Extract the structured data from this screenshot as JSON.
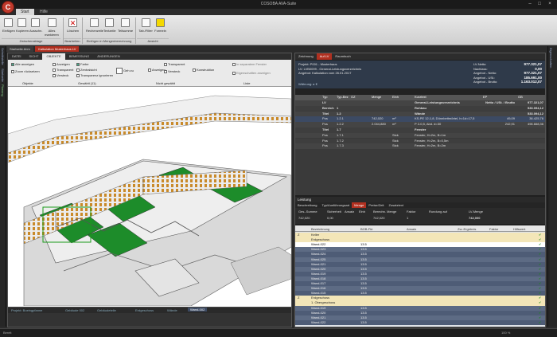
{
  "app": {
    "title": "COSOBA AVA-Suite",
    "logo": "C"
  },
  "ribbon_tabs": [
    "Start",
    "Hilfe"
  ],
  "ribbon": {
    "buttons": [
      "Einfügen",
      "Kopieren",
      "Ausschn.",
      "Alles markieren",
      "Löschen",
      "Rechenzeile",
      "Textzeile",
      "Teilsumme",
      "Tab./Filter",
      "Formeln"
    ],
    "groups": [
      "Zwischenablage",
      "Bearbeiten",
      "Einfügen in Mengenberechnung",
      "Ansicht"
    ]
  },
  "doc_tabs": [
    "Startseite.bbm",
    "Kalkulation Musterhaus LV"
  ],
  "left_sidebar": [
    "Schnittstelle",
    "Startseite",
    "Planung"
  ],
  "right_sidebar": [
    "Eigenschaften"
  ],
  "model": {
    "tabs": [
      "DATEI",
      "SICHT",
      "OBJEKTE",
      "BEMESSUNG",
      "ÄNDERUNGEN"
    ],
    "groups": [
      "Objekte",
      "Gewählt (11)",
      "Nicht gewählt",
      "Liste"
    ],
    "labels": [
      "Alle anzeigen",
      "Zoom rücksetzen",
      "Anzeigen",
      "Transparent",
      "Versteck",
      "Farbe",
      "Zentralsicht",
      "Transparenz ignorieren",
      "Geh zu",
      "Anzeigen",
      "Transparent",
      "Versteck",
      "Konstruktion",
      "In separatem Fenster",
      "Eigenschaften anzeigen"
    ],
    "status": [
      "Projekt: Boeingpfanne",
      "Gebäude 002",
      "Gebäudeteile",
      "Erdgeschoss",
      "Wände",
      "Wand-002"
    ]
  },
  "right_tabs": [
    "Zeichnung",
    "Auf LV",
    "Raumbuch"
  ],
  "info": {
    "lines": [
      "Projekt:    P001 - Musterhaus",
      "LV:          LVB0099 - General-Leistungsverzeichnis",
      "Angebot:   Kalkulation vom 26.01.2017"
    ],
    "labels": [
      "LV-Netto:",
      "Nachlass:",
      "Angebot - Netto:",
      "Angebot - USt.:",
      "Angebot - Brutto:"
    ],
    "values": [
      "977.321,07",
      "0,00",
      "977.321,07",
      "185.691,00",
      "1.163.012,07"
    ],
    "rabatt": "Währung: ▸ €"
  },
  "tree": {
    "headers": [
      "Typ",
      "Typ-Bez",
      "OZ",
      "Menge",
      "Einh",
      "Kurztext",
      "EP",
      "GB"
    ],
    "rows": [
      [
        "LV",
        "",
        "",
        "",
        "",
        "General-Leistungsverzeichnis",
        "Netto / USt. / Brutto",
        "977.321,07"
      ],
      [
        "Bereich",
        "1",
        "",
        "",
        "",
        "Rohbau",
        "",
        "533.094,12"
      ],
      [
        "Titel",
        "1.2",
        "",
        "",
        "",
        "Wände",
        "",
        "533.094,12"
      ],
      [
        "Pos",
        "1.2.1",
        "",
        "742,020",
        "m²",
        "KS-PE 12-1,8, Dünnbettmörtel, h=1d=17,5",
        "49,09",
        "36.425,76"
      ],
      [
        "Pos",
        "1.2.2",
        "",
        "2.044,880",
        "m²",
        "P 2-0,5, Abd. d=30",
        "242,91",
        "496.668,36"
      ],
      [
        "Titel",
        "1.7",
        "",
        "",
        "",
        "Fenster",
        "",
        ""
      ],
      [
        "Pos",
        "1.7.1",
        "",
        "",
        "Stck",
        "Fenster, H=2m, B=1m",
        "",
        ""
      ],
      [
        "Pos",
        "1.7.2",
        "",
        "",
        "Stck",
        "Fenster, H=2m, B=0,5m",
        "",
        ""
      ],
      [
        "Pos",
        "1.7.3",
        "",
        "",
        "Stck",
        "Fenster, H=2m, B=2m",
        "",
        ""
      ]
    ]
  },
  "leistung": {
    "title": "Leistung",
    "tabs": [
      "Beschreibung",
      "Typ/Ausführungsart",
      "Menge",
      "Preise/Zeit",
      "Zusatztext"
    ],
    "form_labels": [
      "Ges.-Summe",
      "Sicherheit",
      "Ansatz",
      "Einh",
      "Berechn. Menge",
      "Faktor",
      "Rundung auf",
      "LV-Menge"
    ],
    "form_values": [
      "742,020",
      "0,00",
      "742,020",
      "1",
      "742,000"
    ],
    "grid_headers": [
      "",
      "Bezeichnung",
      "BGB-Fkt",
      "Ansatz",
      "Zw.-Ergebnis",
      "Faktor",
      "Hilfswert"
    ],
    "rows": [
      [
        "Z",
        "Keller",
        "",
        "",
        "",
        "",
        ""
      ],
      [
        "",
        "Erdgeschoss",
        "",
        "",
        "",
        "",
        ""
      ],
      [
        "",
        "Wand-022",
        "13.5",
        "",
        "",
        "",
        ""
      ],
      [
        "",
        "Wand-023",
        "13.5",
        "",
        "",
        "",
        ""
      ],
      [
        "",
        "Wand-024",
        "13.5",
        "",
        "",
        "",
        ""
      ],
      [
        "",
        "Wand-025",
        "13.5",
        "",
        "",
        "",
        ""
      ],
      [
        "",
        "Wand-021",
        "13.5",
        "",
        "",
        "",
        ""
      ],
      [
        "",
        "Wand-020",
        "13.5",
        "",
        "",
        "",
        ""
      ],
      [
        "",
        "Wand-019",
        "13.5",
        "",
        "",
        "",
        ""
      ],
      [
        "",
        "Wand-018",
        "13.5",
        "",
        "",
        "",
        ""
      ],
      [
        "",
        "Wand-017",
        "13.5",
        "",
        "",
        "",
        ""
      ],
      [
        "",
        "Wand-016",
        "13.5",
        "",
        "",
        "",
        ""
      ],
      [
        "",
        "Wand-015",
        "13.5",
        "",
        "",
        "",
        ""
      ],
      [
        "Z",
        "Erdgeschoss",
        "",
        "",
        "",
        "",
        ""
      ],
      [
        "",
        "1. Obergeschoss",
        "",
        "",
        "",
        "",
        ""
      ],
      [
        "",
        "Wand-019",
        "13.5",
        "",
        "",
        "",
        ""
      ],
      [
        "",
        "Wand-020",
        "13.5",
        "",
        "",
        "",
        ""
      ],
      [
        "",
        "Wand-021",
        "13.5",
        "",
        "",
        "",
        ""
      ],
      [
        "",
        "Wand-022",
        "13.5",
        "",
        "",
        "",
        ""
      ]
    ]
  },
  "status": {
    "left": "Bereit",
    "right": "100 %"
  },
  "colors": {
    "accent": "#b03020",
    "green": "#1a8a1a",
    "selection": "#3c4a63"
  }
}
